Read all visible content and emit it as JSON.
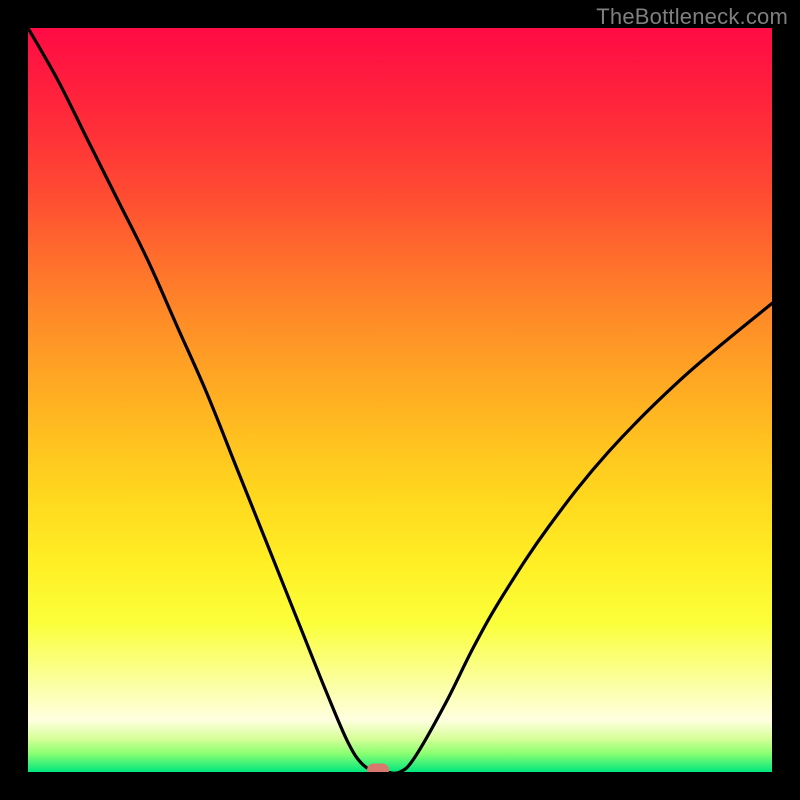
{
  "watermark": "TheBottleneck.com",
  "chart_data": {
    "type": "line",
    "title": "",
    "xlabel": "",
    "ylabel": "",
    "xlim": [
      0,
      100
    ],
    "ylim": [
      0,
      100
    ],
    "grid": false,
    "legend": false,
    "annotations": [],
    "background_gradient": {
      "orientation": "vertical",
      "stops": [
        {
          "pos": 0.0,
          "color": "#ff0b45"
        },
        {
          "pos": 0.5,
          "color": "#ffc020"
        },
        {
          "pos": 0.8,
          "color": "#fbff3a"
        },
        {
          "pos": 0.93,
          "color": "#feffe0"
        },
        {
          "pos": 1.0,
          "color": "#00e77e"
        }
      ]
    },
    "series": [
      {
        "name": "bottleneck-curve",
        "type": "line",
        "color": "#000000",
        "x": [
          0,
          4,
          8,
          12,
          16,
          20,
          24,
          28,
          32,
          36,
          40,
          43,
          45,
          47,
          48,
          50,
          52,
          56,
          60,
          64,
          70,
          78,
          88,
          100
        ],
        "y": [
          100,
          93,
          85,
          77,
          69,
          60,
          51,
          41,
          31,
          21,
          11,
          4,
          1,
          0,
          0,
          0,
          2,
          9,
          17,
          24,
          33,
          43,
          53,
          63
        ]
      }
    ],
    "marker": {
      "name": "optimal-point",
      "x": 47,
      "y": 0,
      "color": "#d9796d"
    }
  }
}
